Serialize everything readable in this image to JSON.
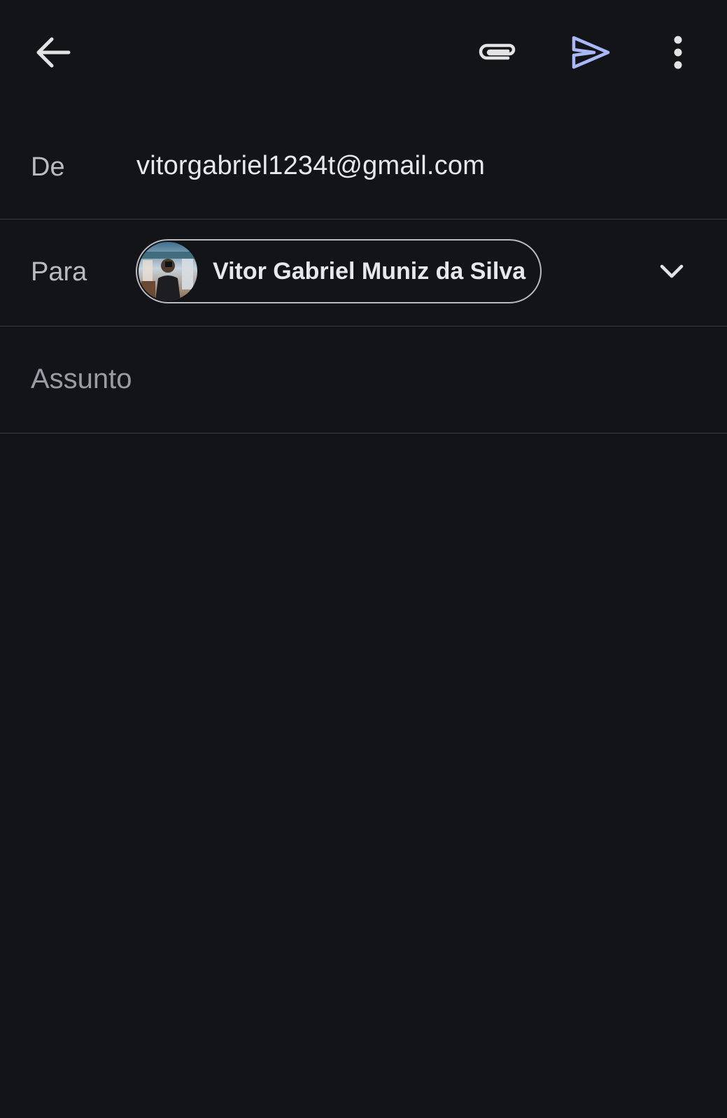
{
  "toolbar": {
    "icons": {
      "back": "arrow-left-icon",
      "attach": "paperclip-icon",
      "send": "send-icon",
      "more": "more-vert-icon"
    },
    "colors": {
      "icon": "#e3e3e6",
      "send_accent": "#a8b8f8"
    }
  },
  "compose": {
    "from": {
      "label": "De",
      "value": "vitorgabriel1234t@gmail.com"
    },
    "to": {
      "label": "Para",
      "recipients": [
        {
          "name": "Vitor Gabriel Muniz da Silva",
          "avatar": "person-photo-avatar"
        }
      ],
      "expand_icon": "chevron-down-icon"
    },
    "subject": {
      "placeholder": "Assunto",
      "value": ""
    },
    "body": {
      "value": ""
    }
  },
  "theme": {
    "background": "#131418",
    "divider": "#3a3b40",
    "label": "#b9bbc1",
    "text": "#e7e8eb"
  }
}
